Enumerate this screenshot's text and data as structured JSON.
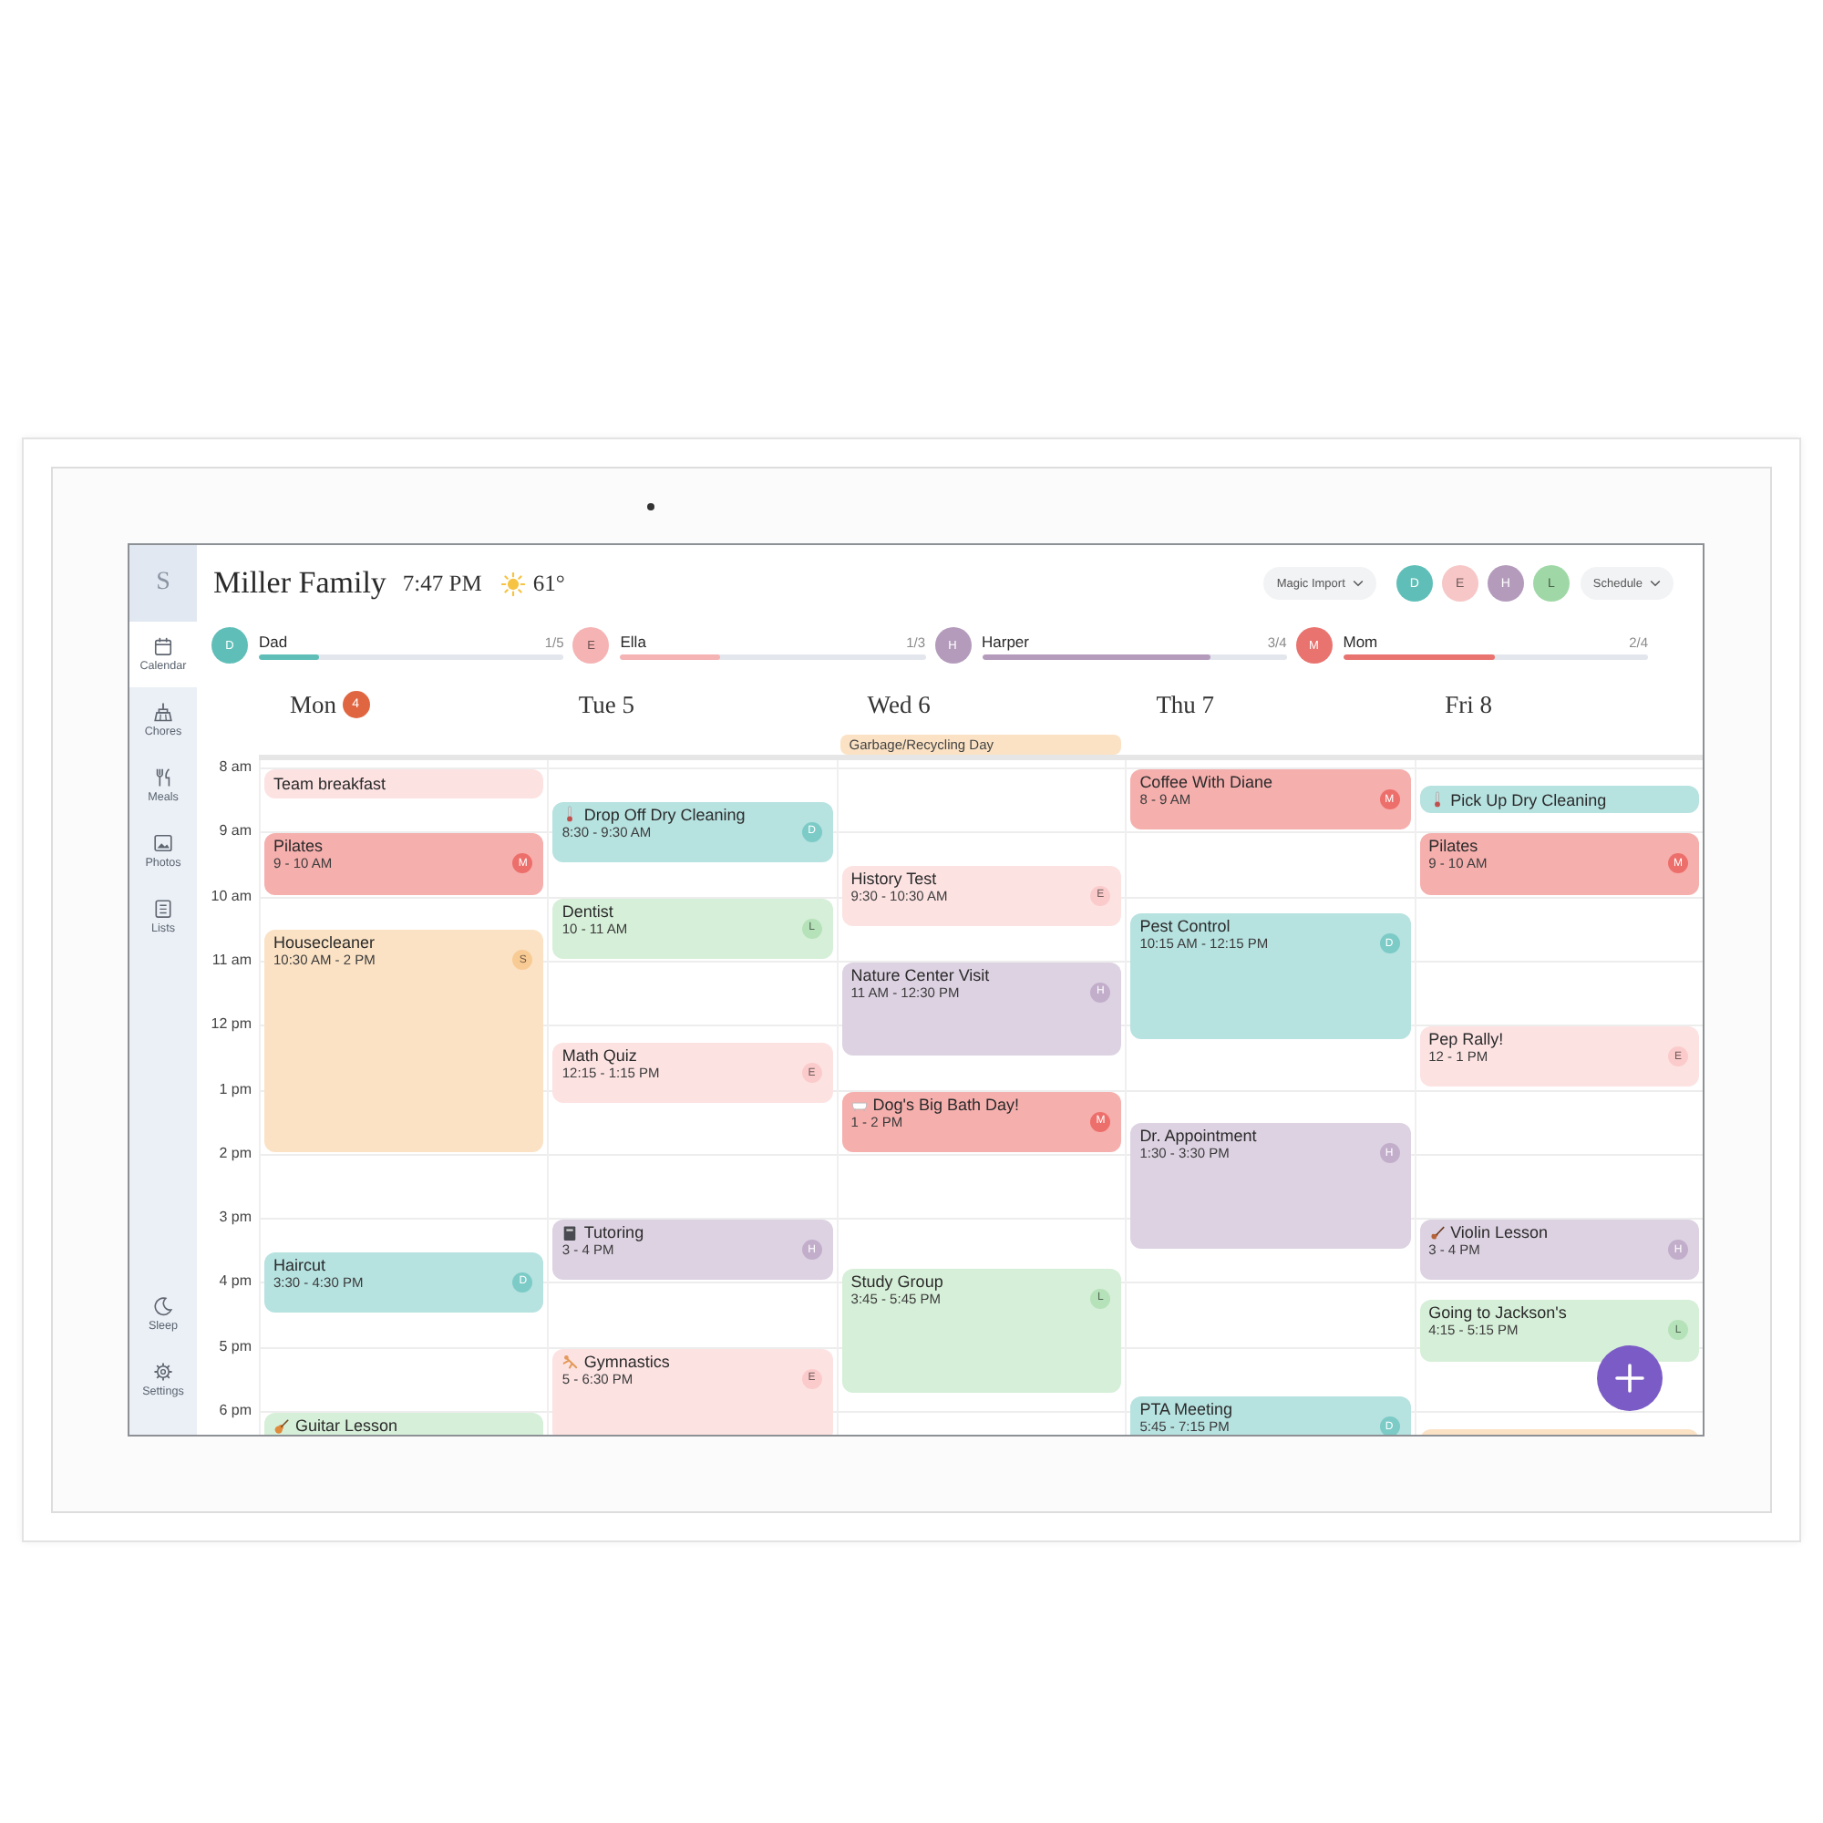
{
  "sidebar": {
    "logo": "S",
    "items": [
      {
        "label": "Calendar",
        "selected": true
      },
      {
        "label": "Chores",
        "selected": false
      },
      {
        "label": "Meals",
        "selected": false
      },
      {
        "label": "Photos",
        "selected": false
      },
      {
        "label": "Lists",
        "selected": false
      }
    ],
    "bottom_items": [
      {
        "label": "Sleep",
        "selected": false
      },
      {
        "label": "Settings",
        "selected": false
      }
    ]
  },
  "header": {
    "title": "Miller Family",
    "time": "7:47 PM",
    "temperature": "61°",
    "import_button": "Magic Import",
    "profiles": [
      {
        "initial": "D",
        "color": "#5fbfb8"
      },
      {
        "initial": "E",
        "color": "#f7c6c6"
      },
      {
        "initial": "H",
        "color": "#b49bbc"
      },
      {
        "initial": "L",
        "color": "#9fd8a6"
      }
    ],
    "view_button": "Schedule"
  },
  "chores": [
    {
      "initial": "D",
      "name": "Dad",
      "count": "1/5",
      "level": 0.2,
      "color": "#5fbfb8"
    },
    {
      "initial": "E",
      "name": "Ella",
      "count": "1/3",
      "level": 0.33,
      "color": "#f5b3b4"
    },
    {
      "initial": "H",
      "name": "Harper",
      "count": "3/4",
      "level": 0.75,
      "color": "#b49bbc"
    },
    {
      "initial": "M",
      "name": "Mom",
      "count": "2/4",
      "level": 0.5,
      "color": "#e9736f"
    }
  ],
  "calendar": {
    "hours": [
      "8 am",
      "9 am",
      "10 am",
      "11 am",
      "12 pm",
      "1 pm",
      "2 pm",
      "3 pm",
      "4 pm",
      "5 pm",
      "6 pm"
    ],
    "days": [
      {
        "weekday": "Mon",
        "date": "4",
        "today": true,
        "events": [
          {
            "title": "Team breakfast",
            "color": "#fde2e2",
            "kind": "plain"
          },
          {
            "title": "Pilates",
            "time": "9 - 10 AM",
            "color": "#f5afad",
            "badge": "M",
            "kind": "plain"
          },
          {
            "title": "Housecleaner",
            "time": "10:30 AM - 2 PM",
            "color": "#fbe2c4",
            "badge": "S",
            "kind": "plain"
          },
          {
            "title": "Haircut",
            "time": "3:30 - 4:30 PM",
            "color": "#b6e2e0",
            "badge": "D",
            "kind": "plain"
          },
          {
            "title": "Guitar Lesson",
            "color": "#d6efd8",
            "kind": "guitar"
          }
        ]
      },
      {
        "weekday": "Tue",
        "date": "5",
        "today": false,
        "events": [
          {
            "title": "Drop Off Dry Cleaning",
            "time": "8:30 - 9:30 AM",
            "color": "#b6e2e0",
            "badge": "D",
            "kind": "errand"
          },
          {
            "title": "Dentist",
            "time": "10 - 11 AM",
            "color": "#d6efd8",
            "badge": "L",
            "kind": "plain"
          },
          {
            "title": "Math Quiz",
            "time": "12:15 - 1:15 PM",
            "color": "#fde2e2",
            "badge": "E",
            "kind": "plain"
          },
          {
            "title": "Tutoring",
            "time": "3 - 4 PM",
            "color": "#ddd2e2",
            "badge": "H",
            "kind": "tutoring"
          },
          {
            "title": "Gymnastics",
            "time": "5 - 6:30 PM",
            "color": "#fde2e2",
            "badge": "E",
            "kind": "gymnastics"
          }
        ]
      },
      {
        "weekday": "Wed",
        "date": "6",
        "today": false,
        "all_day": [
          {
            "title": "Garbage/Recycling Day",
            "color": "#fbe2c4"
          }
        ],
        "events": [
          {
            "title": "History Test",
            "time": "9:30 - 10:30 AM",
            "color": "#fde2e2",
            "badge": "E",
            "kind": "plain"
          },
          {
            "title": "Nature Center Visit",
            "time": "11 AM - 12:30 PM",
            "color": "#ddd2e2",
            "badge": "H",
            "kind": "plain"
          },
          {
            "title": "Dog's Big Bath Day!",
            "time": "1 - 2 PM",
            "color": "#f5afad",
            "badge": "M",
            "kind": "bath"
          },
          {
            "title": "Study Group",
            "time": "3:45 - 5:45 PM",
            "color": "#d6efd8",
            "badge": "L",
            "kind": "plain"
          }
        ]
      },
      {
        "weekday": "Thu",
        "date": "7",
        "today": false,
        "events": [
          {
            "title": "Coffee With Diane",
            "time": "8 - 9 AM",
            "color": "#f5afad",
            "badge": "M",
            "kind": "plain"
          },
          {
            "title": "Pest Control",
            "time": "10:15 AM - 12:15 PM",
            "color": "#b6e2e0",
            "badge": "D",
            "kind": "plain"
          },
          {
            "title": "Dr. Appointment",
            "time": "1:30 - 3:30 PM",
            "color": "#ddd2e2",
            "badge": "H",
            "kind": "plain"
          },
          {
            "title": "PTA Meeting",
            "time": "5:45 - 7:15 PM",
            "color": "#b6e2e0",
            "badge": "D",
            "kind": "plain"
          }
        ]
      },
      {
        "weekday": "Fri",
        "date": "8",
        "today": false,
        "events": [
          {
            "title": "Pick Up Dry Cleaning",
            "color": "#b6e2e0",
            "kind": "errand"
          },
          {
            "title": "Pilates",
            "time": "9 - 10 AM",
            "color": "#f5afad",
            "badge": "M",
            "kind": "plain"
          },
          {
            "title": "Pep Rally!",
            "time": "12 - 1 PM",
            "color": "#fde2e2",
            "badge": "E",
            "kind": "plain"
          },
          {
            "title": "Violin Lesson",
            "time": "3 - 4 PM",
            "color": "#ddd2e2",
            "badge": "H",
            "kind": "violin"
          },
          {
            "title": "Going to Jackson's",
            "time": "4:15 - 5:15 PM",
            "color": "#d6efd8",
            "badge": "L",
            "kind": "plain"
          },
          {
            "color": "#fbe2c4",
            "kind": "plain"
          }
        ]
      }
    ]
  }
}
